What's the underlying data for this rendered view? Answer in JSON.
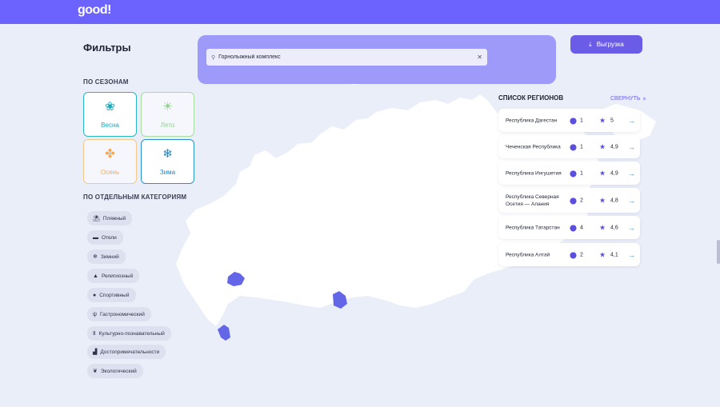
{
  "header": {
    "logo": "good!"
  },
  "filters": {
    "title": "Фильтры",
    "seasons_label": "ПО СЕЗОНАМ",
    "seasons": [
      {
        "label": "Весна",
        "icon": "flower-icon"
      },
      {
        "label": "Лето",
        "icon": "sun-icon"
      },
      {
        "label": "Осень",
        "icon": "maple-leaf-icon"
      },
      {
        "label": "Зима",
        "icon": "snowflake-icon"
      }
    ],
    "categories_label": "ПО ОТДЕЛЬНЫМ КАТЕГОРИЯМ",
    "categories": [
      {
        "label": "Пляжный",
        "icon": "beach-umbrella-icon"
      },
      {
        "label": "Отели",
        "icon": "bed-icon"
      },
      {
        "label": "Зимний",
        "icon": "snowflake-icon"
      },
      {
        "label": "Религиозный",
        "icon": "church-icon"
      },
      {
        "label": "Спортивный",
        "icon": "ball-icon"
      },
      {
        "label": "Гастрономический",
        "icon": "fork-knife-icon"
      },
      {
        "label": "Культурно-познавательный",
        "icon": "column-icon"
      },
      {
        "label": "Достопримечательности",
        "icon": "landmark-icon"
      },
      {
        "label": "Экологический",
        "icon": "leaf-icon"
      }
    ]
  },
  "search": {
    "value": "Горнолыжный комплекс",
    "placeholder": ""
  },
  "export": {
    "label": "Выгрузка"
  },
  "regions": {
    "title": "СПИСОК РЕГИОНОВ",
    "collapse_label": "СВЕРНУТЬ",
    "items": [
      {
        "name": "Республика Дагестан",
        "count": "1",
        "rating": "5"
      },
      {
        "name": "Чеченская Республика",
        "count": "1",
        "rating": "4,9"
      },
      {
        "name": "Республика Ингушетия",
        "count": "1",
        "rating": "4,9"
      },
      {
        "name": "Республика Северная Осетия — Алания",
        "count": "2",
        "rating": "4,8"
      },
      {
        "name": "Республика Татарстан",
        "count": "4",
        "rating": "4,6"
      },
      {
        "name": "Республика Алтай",
        "count": "2",
        "rating": "4,1"
      }
    ]
  },
  "colors": {
    "accent": "#6c63ff",
    "search_panel": "#9e9af9",
    "highlight_region": "#6466e8",
    "map_land": "#ffffff",
    "background": "#e9eef8"
  }
}
